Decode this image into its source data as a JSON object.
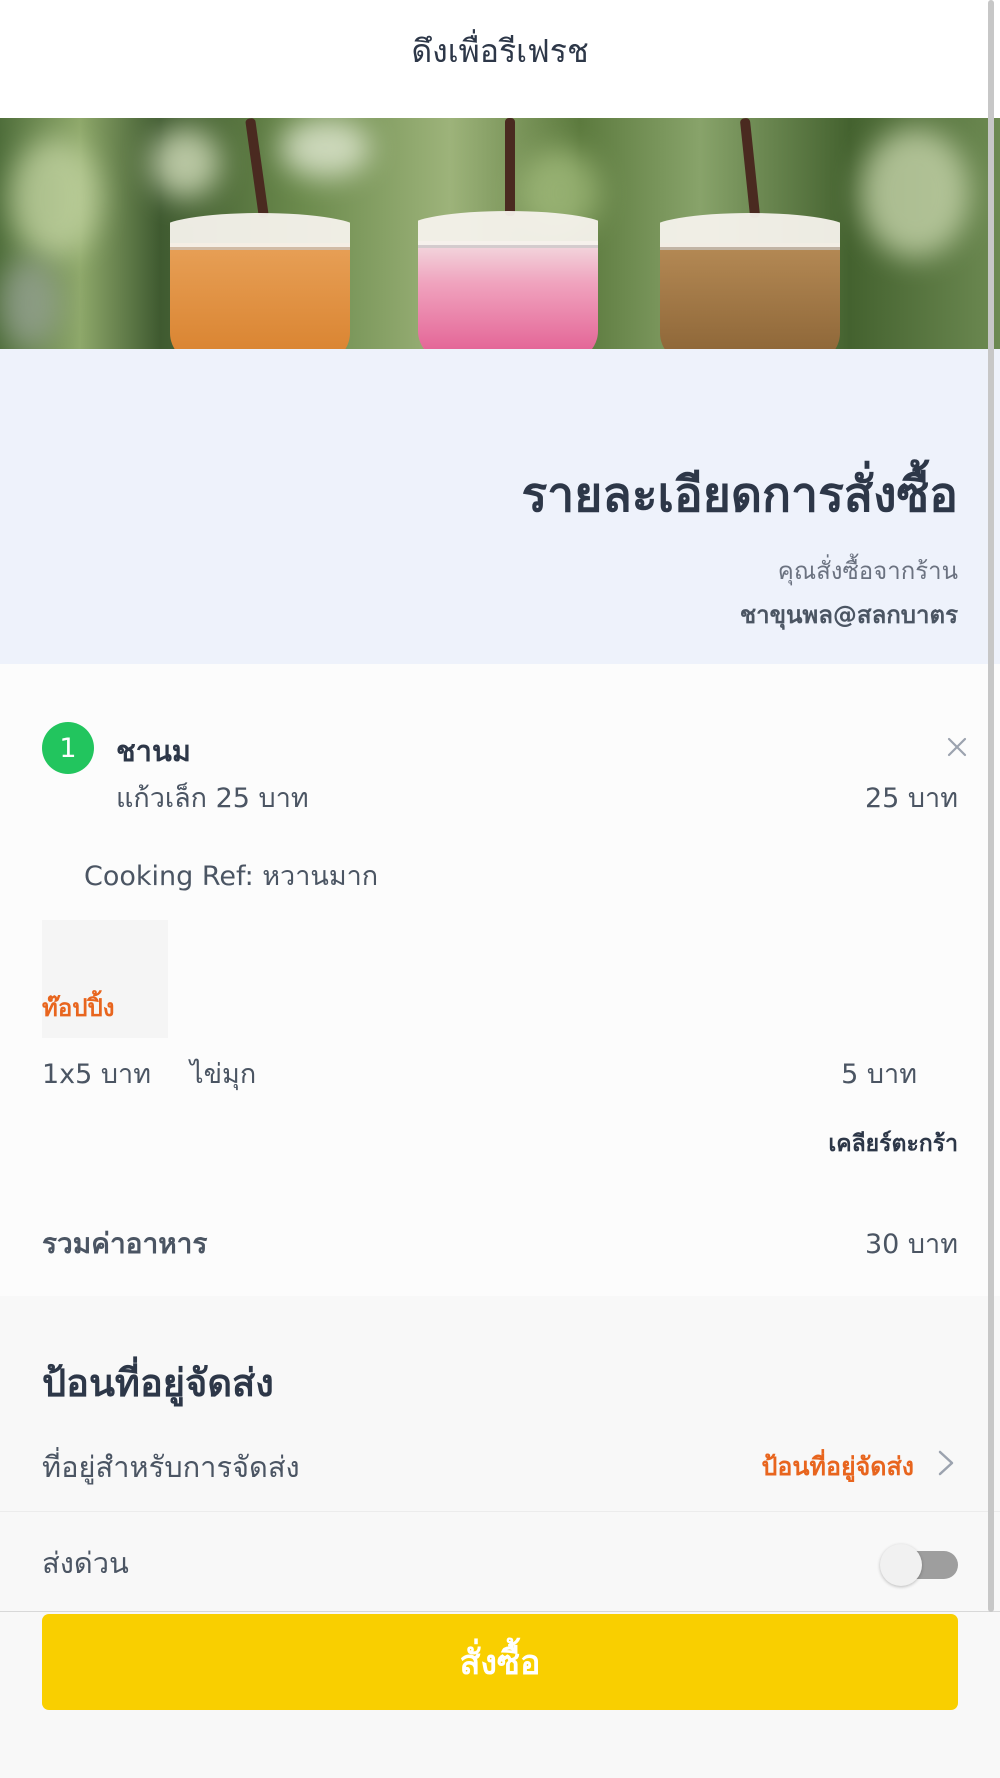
{
  "header": {
    "title": "ดึงเพื่อรีเฟรช"
  },
  "order": {
    "title": "รายละเอียดการสั่งซื้อ",
    "from_label": "คุณสั่งซื้อจากร้าน",
    "shop_name": "ชาขุนพล@สลกบาตร"
  },
  "item": {
    "index": "1",
    "name": "ชานม",
    "size": "แก้วเล็ก 25 บาท",
    "price": "25 บาท",
    "cooking_ref": "Cooking Ref: หวานมาก",
    "remove_icon": "close-icon"
  },
  "topping": {
    "section_label": "ท๊อปปิ้ง",
    "qty": "1x5 บาท",
    "name": "ไข่มุก",
    "price": "5 บาท"
  },
  "cart": {
    "clear_label": "เคลียร์ตะกร้า",
    "subtotal_label": "รวมค่าอาหาร",
    "subtotal_value": "30 บาท"
  },
  "delivery": {
    "title": "ป้อนที่อยู่จัดส่ง",
    "address_label": "ที่อยู่สำหรับการจัดส่ง",
    "address_action": "ป้อนที่อยู่จัดส่ง",
    "express_label": "ส่งด่วน",
    "express_enabled": false
  },
  "order_button": {
    "label": "สั่งซื้อ"
  },
  "colors": {
    "accent_orange": "#e8651e",
    "badge_green": "#22c55e",
    "button_yellow": "#f9cf00"
  }
}
